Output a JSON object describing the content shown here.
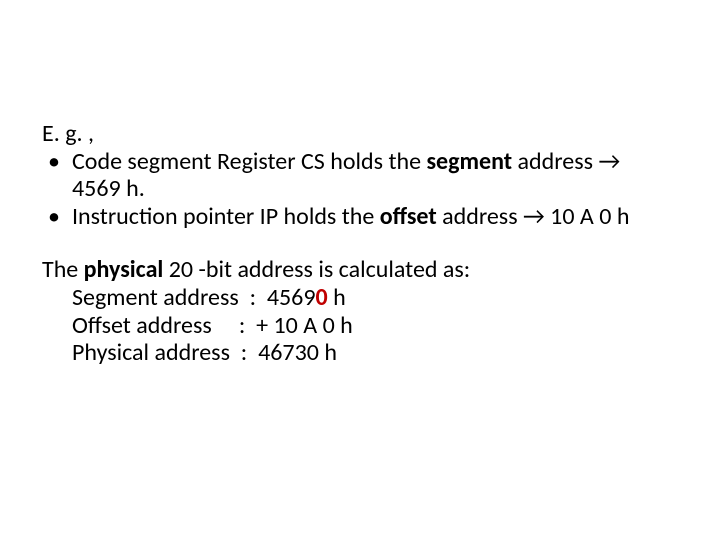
{
  "eg": "E. g. ,",
  "bullet1": {
    "pre": "Code segment Register CS holds the ",
    "bold": "segment",
    "post1": " address ",
    "arrow": "→",
    "post2": " 4569 h."
  },
  "bullet2": {
    "pre": "Instruction pointer IP holds the ",
    "bold": "offset",
    "post1": " address ",
    "arrow": "→",
    "post2": " 10 A 0 h"
  },
  "calc": {
    "intro_pre": "The ",
    "intro_bold": "physical",
    "intro_post": " 20 -bit address is calculated as:",
    "seg_label": "Segment address  :  4569",
    "seg_zero": "0",
    "seg_suffix": " h",
    "off": "Offset address     :  + 10 A 0 h",
    "phys": "Physical address  :  46730 h"
  }
}
